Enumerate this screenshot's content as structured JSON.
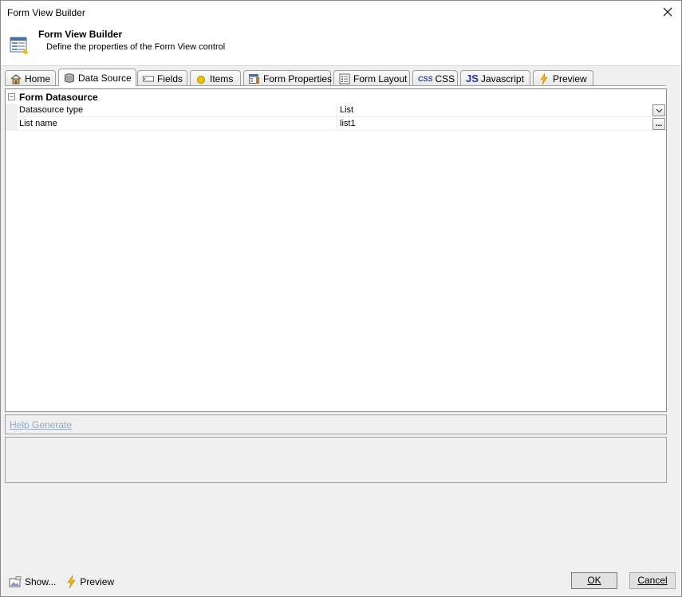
{
  "window": {
    "title": "Form View Builder"
  },
  "header": {
    "title": "Form View Builder",
    "subtitle": "Define the properties of the Form View control"
  },
  "tabs": [
    {
      "label": "Home",
      "icon": "home-icon"
    },
    {
      "label": "Data Source",
      "icon": "database-icon",
      "active": true
    },
    {
      "label": "Fields",
      "icon": "textbox-icon"
    },
    {
      "label": "Items",
      "icon": "circle-icon"
    },
    {
      "label": "Form Properties",
      "icon": "form-properties-icon"
    },
    {
      "label": "Form Layout",
      "icon": "layout-icon"
    },
    {
      "label": "CSS",
      "icon": "css-icon",
      "icon_text": "CSS"
    },
    {
      "label": "Javascript",
      "icon": "js-icon",
      "icon_text": "JS"
    },
    {
      "label": "Preview",
      "icon": "lightning-icon"
    }
  ],
  "grid": {
    "category": "Form Datasource",
    "rows": [
      {
        "name": "Datasource type",
        "value": "List",
        "editor": "dropdown"
      },
      {
        "name": "List name",
        "value": "list1",
        "editor": "ellipsis",
        "button_label": "..."
      }
    ]
  },
  "help": {
    "link_label": "Help Generate"
  },
  "footer": {
    "show_label": "Show...",
    "preview_label": "Preview",
    "ok_label": "OK",
    "cancel_label": "Cancel"
  },
  "colors": {
    "link_disabled": "#8fa9c7",
    "lightning": "#f2b705",
    "js_text": "#1f3c9c",
    "css_text": "#2c4ca3"
  }
}
